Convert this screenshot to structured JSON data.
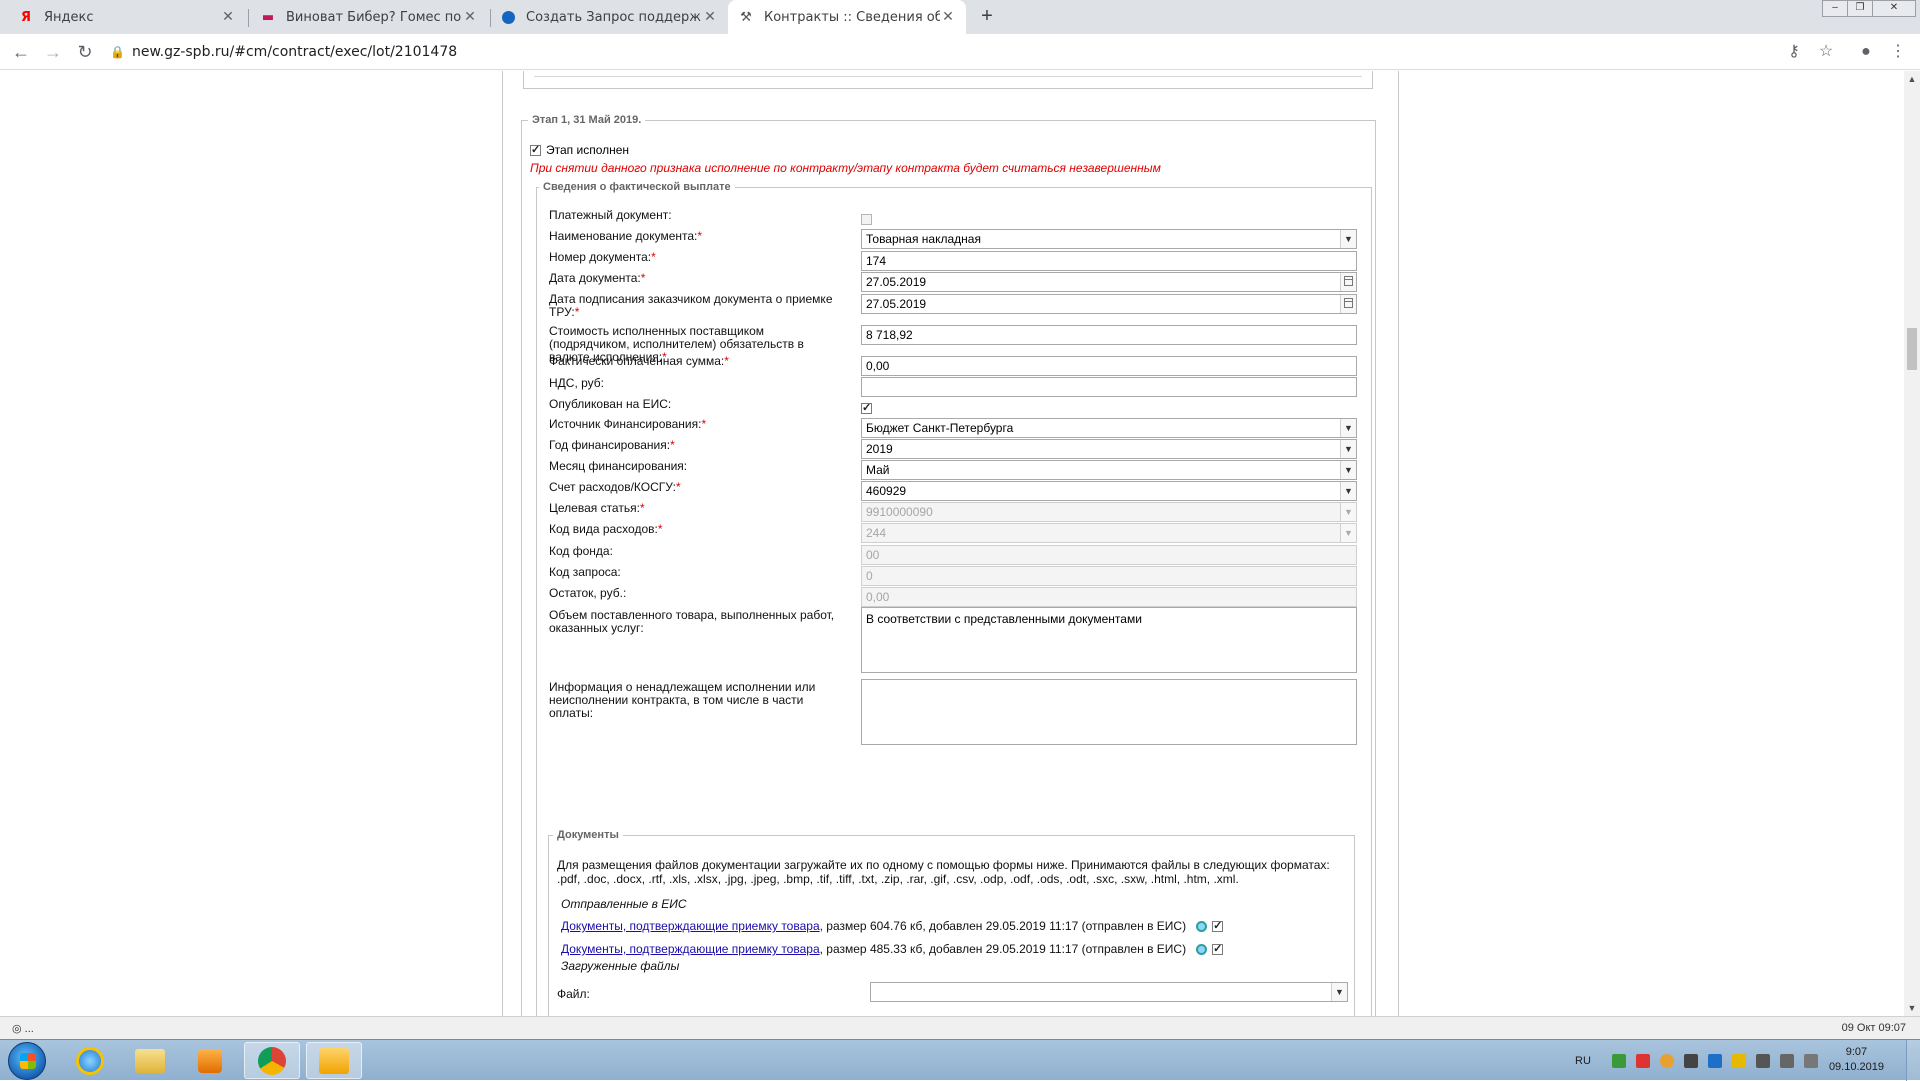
{
  "browser": {
    "tabs": [
      {
        "title": "Яндекс",
        "icon": "yandex-icon"
      },
      {
        "title": "Виноват Бибер? Гомес показал",
        "icon": "news-icon"
      },
      {
        "title": "Создать Запрос поддержки - Al",
        "icon": "support-icon"
      },
      {
        "title": "Контракты :: Сведения об испол",
        "icon": "tools-icon",
        "active": true
      }
    ],
    "new_tab": "+",
    "url": "new.gz-spb.ru/#cm/contract/exec/lot/2101478"
  },
  "stage": {
    "legend": "Этап 1, 31 Май 2019.",
    "completed_label": "Этап исполнен",
    "completed_checked": true,
    "warning": "При снятии данного признака исполнение по контракту/этапу контракта будет считаться незавершенным"
  },
  "payment": {
    "legend": "Сведения о фактической выплате",
    "fields": {
      "payment_doc": {
        "label": "Платежный документ:",
        "checked": false
      },
      "doc_name": {
        "label": "Наименование документа:",
        "value": "Товарная накладная"
      },
      "doc_number": {
        "label": "Номер документа:",
        "value": "174"
      },
      "doc_date": {
        "label": "Дата документа:",
        "value": "27.05.2019"
      },
      "sign_date": {
        "label": "Дата подписания заказчиком документа о приемке ТРУ:",
        "value": "27.05.2019"
      },
      "cost": {
        "label": "Стоимость исполненных поставщиком (подрядчиком, исполнителем) обязательств в валюте исполнения:",
        "value": "8 718,92"
      },
      "paid_sum": {
        "label": "Фактически оплаченная сумма:",
        "value": "0,00"
      },
      "vat": {
        "label": "НДС, руб:",
        "value": ""
      },
      "published": {
        "label": "Опубликован на ЕИС:",
        "checked": true
      },
      "fin_source": {
        "label": "Источник Финансирования:",
        "value": "Бюджет Санкт-Петербурга"
      },
      "fin_year": {
        "label": "Год финансирования:",
        "value": "2019"
      },
      "fin_month": {
        "label": "Месяц финансирования:",
        "value": "Май"
      },
      "kosgu": {
        "label": "Счет расходов/КОСГУ:",
        "value": "460929"
      },
      "target_article": {
        "label": "Целевая статья:",
        "value": "9910000090"
      },
      "expense_type": {
        "label": "Код вида расходов:",
        "value": "244"
      },
      "fund_code": {
        "label": "Код фонда:",
        "value": "00"
      },
      "request_code": {
        "label": "Код запроса:",
        "value": "0"
      },
      "remainder": {
        "label": "Остаток, руб.:",
        "value": "0,00"
      },
      "volume": {
        "label": "Объем поставленного товара, выполненных работ, оказанных услуг:",
        "value": "В соответствии с представленными документами"
      },
      "improper": {
        "label": "Информация о ненадлежащем исполнении или неисполнении контракта, в том числе в части оплаты:",
        "value": ""
      }
    }
  },
  "documents": {
    "legend": "Документы",
    "info": "Для размещения файлов документации загружайте их по одному с помощью формы ниже. Принимаются файлы в следующих форматах: .pdf, .doc, .docx, .rtf, .xls, .xlsx, .jpg, .jpeg, .bmp, .tif, .tiff, .txt, .zip, .rar, .gif, .csv, .odp, .odf, .ods, .odt, .sxc, .sxw, .html, .htm, .xml.",
    "sent_heading": "Отправленные в ЕИС",
    "files": [
      {
        "link": "Документы, подтверждающие приемку товара",
        "meta": ", размер 604.76 кб, добавлен 29.05.2019 11:17 (отправлен в ЕИС)",
        "checked": true
      },
      {
        "link": "Документы, подтверждающие приемку товара",
        "meta": ", размер 485.33 кб, добавлен 29.05.2019 11:17 (отправлен в ЕИС)",
        "checked": true
      }
    ],
    "uploaded_heading": "Загруженные файлы",
    "file_label": "Файл:"
  },
  "statusbar": {
    "left": "◎ ...",
    "right": "09 Окт 09:07"
  },
  "taskbar": {
    "apps": [
      "windows-start",
      "internet-explorer",
      "file-explorer",
      "media-player",
      "chrome",
      "outlook"
    ],
    "lang": "RU",
    "time": "9:07",
    "date": "09.10.2019"
  },
  "colors": {
    "required": "#e00000",
    "warning": "#e00000",
    "link": "#1a0dab"
  }
}
